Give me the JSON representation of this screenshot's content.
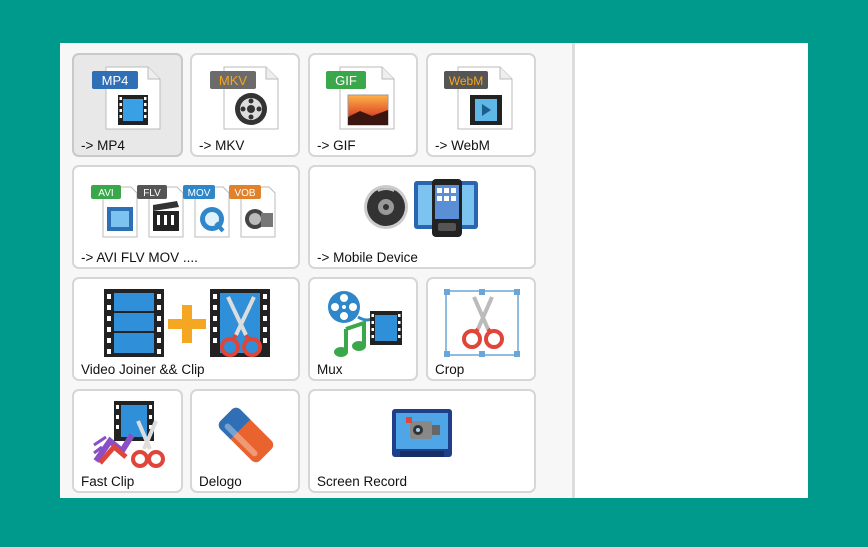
{
  "tiles": [
    {
      "label": "-> MP4",
      "badge": "MP4",
      "icon": "mp4-file-icon"
    },
    {
      "label": "-> MKV",
      "badge": "MKV",
      "icon": "mkv-file-icon"
    },
    {
      "label": "-> GIF",
      "badge": "GIF",
      "icon": "gif-file-icon"
    },
    {
      "label": "-> WebM",
      "badge": "WebM",
      "icon": "webm-file-icon"
    },
    {
      "label": "-> AVI FLV MOV ....",
      "badges": [
        "AVI",
        "FLV",
        "MOV",
        "VOB"
      ],
      "icon": "multi-format-files-icon"
    },
    {
      "label": "-> Mobile Device",
      "icon": "mobile-device-icon"
    },
    {
      "label": "Video Joiner && Clip",
      "icon": "joiner-clip-icon"
    },
    {
      "label": "Mux",
      "icon": "mux-icon"
    },
    {
      "label": "Crop",
      "icon": "crop-icon"
    },
    {
      "label": "Fast Clip",
      "icon": "fast-clip-icon"
    },
    {
      "label": "Delogo",
      "icon": "eraser-icon"
    },
    {
      "label": "Screen Record",
      "icon": "screen-record-icon"
    }
  ],
  "colors": {
    "background": "#009a8c",
    "mp4_badge": "#2f6fb5",
    "mkv_badge": "#6b6b6b",
    "gif_badge": "#3aa84a",
    "webm_badge": "#555555",
    "avi_badge": "#3aa84a",
    "flv_badge": "#555555",
    "mov_badge": "#2f86c8",
    "vob_badge": "#e0822b"
  }
}
